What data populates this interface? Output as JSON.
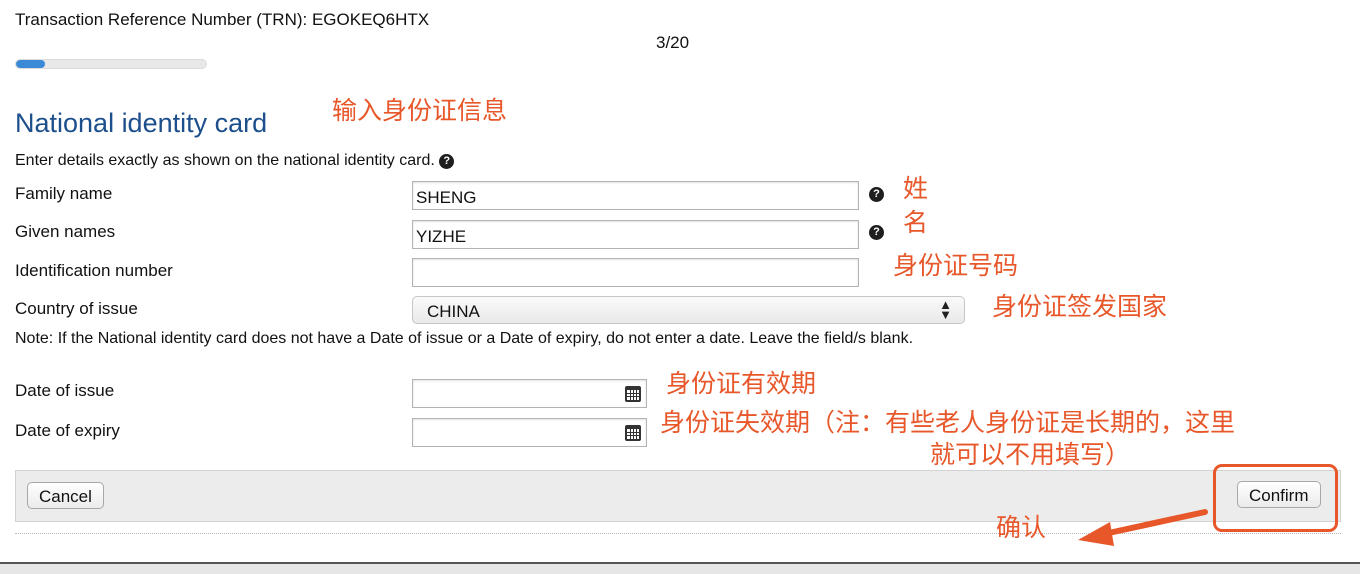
{
  "header": {
    "trn": "Transaction Reference Number (TRN): EGOKEQ6HTX",
    "progress_label": "3/20",
    "progress_fraction": 0.15
  },
  "page_title": "National identity card",
  "intro_text": "Enter details exactly as shown on the national identity card.",
  "help_glyph": "?",
  "fields": {
    "family_name": {
      "label": "Family name",
      "value": "SHENG"
    },
    "given_names": {
      "label": "Given names",
      "value": "YIZHE"
    },
    "identification_number": {
      "label": "Identification number",
      "value": ""
    },
    "country_of_issue": {
      "label": "Country of issue",
      "value": "CHINA"
    }
  },
  "note": "Note: If the National identity card does not have a Date of issue or a Date of expiry, do not enter a date. Leave the field/s blank.",
  "dates": {
    "date_of_issue": {
      "label": "Date of issue",
      "value": ""
    },
    "date_of_expiry": {
      "label": "Date of expiry",
      "value": ""
    }
  },
  "buttons": {
    "cancel": "Cancel",
    "confirm": "Confirm"
  },
  "annotations": {
    "enter_id_info": "输入身份证信息",
    "surname_1": "姓",
    "surname_2": "名",
    "id_number": "身份证号码",
    "issuing_country": "身份证签发国家",
    "valid_from": "身份证有效期",
    "expiry_line1": "身份证失效期（注：有些老人身份证是长期的，这里",
    "expiry_line2": "就可以不用填写）",
    "confirm_hint": "确认"
  },
  "colors": {
    "annotation": "#e8572a",
    "title": "#1c4f8c",
    "progress": "#3a8ad6"
  },
  "icons": {
    "help": "question-circle-icon",
    "calendar": "calendar-icon",
    "select": "select-arrows-icon",
    "arrow": "annotation-arrow-icon"
  }
}
